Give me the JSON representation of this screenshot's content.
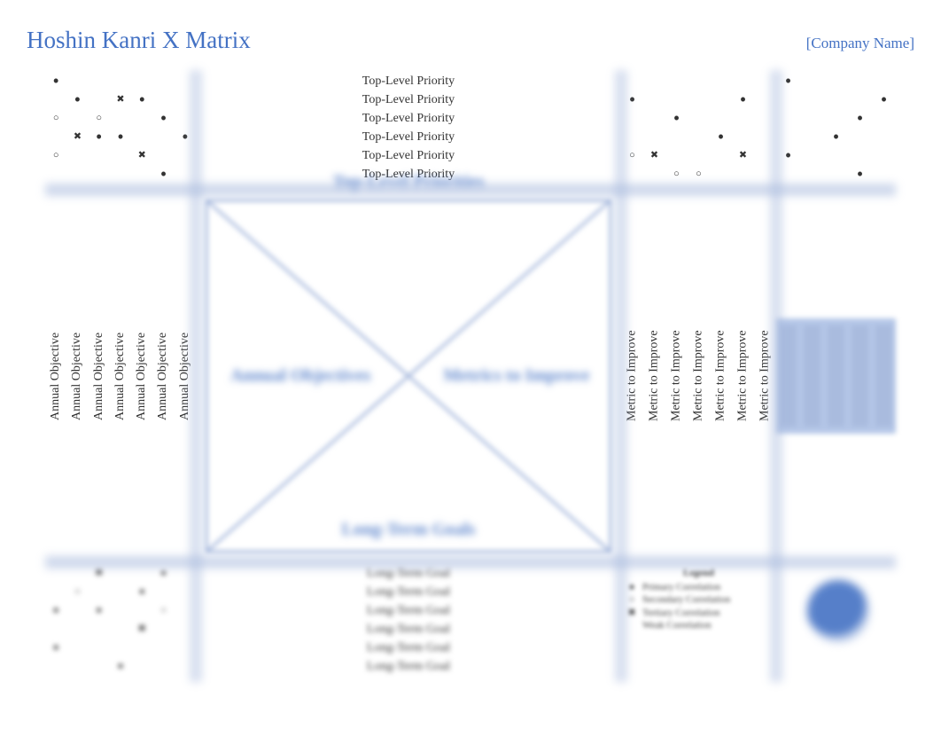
{
  "header": {
    "title": "Hoshin Kanri X Matrix",
    "company": "[Company Name]"
  },
  "symbols": {
    "primary": "dot",
    "secondary": "circle",
    "tertiary": "cross"
  },
  "priorities": [
    "Top-Level Priority",
    "Top-Level Priority",
    "Top-Level Priority",
    "Top-Level Priority",
    "Top-Level Priority",
    "Top-Level Priority"
  ],
  "annual_objectives": [
    "Annual Objective",
    "Annual Objective",
    "Annual Objective",
    "Annual Objective",
    "Annual Objective",
    "Annual Objective",
    "Annual Objective"
  ],
  "metrics": [
    "Metric to Improve",
    "Metric to Improve",
    "Metric to Improve",
    "Metric to Improve",
    "Metric to Improve",
    "Metric to Improve",
    "Metric to Improve"
  ],
  "long_term_goals": [
    "Long-Term Goal",
    "Long-Term Goal",
    "Long-Term Goal",
    "Long-Term Goal",
    "Long-Term Goal",
    "Long-Term Goal"
  ],
  "x_labels": {
    "top": "Top-Level Priorities",
    "left": "Annual Objectives",
    "right": "Metrics to Improve",
    "bottom": "Long-Term Goals"
  },
  "legend_labels": {
    "title": "Legend",
    "primary": "Primary Correlation",
    "secondary": "Secondary Correlation",
    "tertiary": "Tertiary Correlation",
    "weak": "Weak Correlation"
  },
  "rel_top_left": [
    [
      "dot",
      "",
      "",
      "",
      "",
      "",
      ""
    ],
    [
      "",
      "dot",
      "",
      "cross",
      "dot",
      "",
      ""
    ],
    [
      "circle",
      "",
      "circle",
      "",
      "",
      "dot",
      ""
    ],
    [
      "",
      "cross",
      "dot",
      "dot",
      "",
      "",
      "dot"
    ],
    [
      "circle",
      "",
      "",
      "",
      "cross",
      "",
      ""
    ],
    [
      "",
      "",
      "",
      "",
      "",
      "dot",
      ""
    ]
  ],
  "rel_top_right": [
    [
      "",
      "",
      "",
      "",
      "",
      "",
      ""
    ],
    [
      "dot",
      "",
      "",
      "",
      "",
      "dot",
      ""
    ],
    [
      "",
      "",
      "dot",
      "",
      "",
      "",
      ""
    ],
    [
      "",
      "",
      "",
      "",
      "dot",
      "",
      ""
    ],
    [
      "circle",
      "cross",
      "",
      "",
      "",
      "cross",
      ""
    ],
    [
      "",
      "",
      "circle",
      "circle",
      "",
      "",
      ""
    ]
  ],
  "rel_top_far": [
    [
      "dot",
      "",
      "",
      "",
      ""
    ],
    [
      "",
      "",
      "",
      "",
      "dot"
    ],
    [
      "",
      "",
      "",
      "dot",
      ""
    ],
    [
      "",
      "",
      "dot",
      "",
      ""
    ],
    [
      "dot",
      "",
      "",
      "",
      ""
    ],
    [
      "",
      "",
      "",
      "dot",
      ""
    ]
  ],
  "rel_bot_left": [
    [
      "",
      "",
      "cross",
      "",
      "",
      "dot",
      ""
    ],
    [
      "",
      "circle",
      "",
      "",
      "dot",
      "",
      ""
    ],
    [
      "dot",
      "",
      "dot",
      "",
      "",
      "circle",
      ""
    ],
    [
      "",
      "",
      "",
      "",
      "cross",
      "",
      ""
    ],
    [
      "dot",
      "",
      "",
      "",
      "",
      "",
      ""
    ],
    [
      "",
      "",
      "",
      "dot",
      "",
      "",
      ""
    ]
  ],
  "rel_bot_right": [
    [
      "",
      "",
      "",
      "",
      "",
      "",
      ""
    ],
    [
      "",
      "",
      "",
      "",
      "",
      "",
      ""
    ],
    [
      "",
      "",
      "",
      "",
      "",
      "",
      ""
    ],
    [
      "",
      "",
      "",
      "",
      "",
      "",
      ""
    ],
    [
      "",
      "",
      "",
      "",
      "",
      "",
      ""
    ],
    [
      "",
      "",
      "",
      "",
      "",
      "",
      ""
    ]
  ],
  "target_bars": 5
}
